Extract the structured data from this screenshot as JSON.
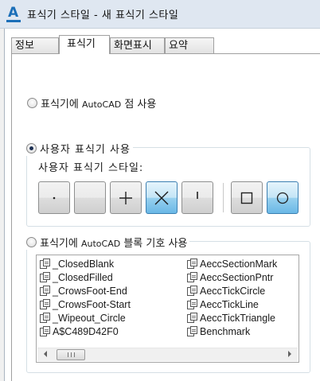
{
  "window": {
    "title": "표식기 스타일 - 새 표식기 스타일"
  },
  "tabs": [
    {
      "label": "정보",
      "active": false
    },
    {
      "label": "표식기",
      "active": true
    },
    {
      "label": "화면표시",
      "active": false
    },
    {
      "label": "요약",
      "active": false
    }
  ],
  "marker_options": {
    "autocad_point": {
      "prefix": "표식기에 ",
      "app": "AutoCAD",
      "suffix": " 점 사용",
      "selected": false
    },
    "custom_marker": {
      "label": "사용자 표식기 사용",
      "selected": true
    },
    "custom_style_label": "사용자 표식기 스타일:",
    "custom_buttons": [
      {
        "name": "dot",
        "selected": false
      },
      {
        "name": "none",
        "selected": false
      },
      {
        "name": "plus",
        "selected": false
      },
      {
        "name": "x",
        "selected": true
      },
      {
        "name": "tick",
        "selected": false
      },
      {
        "name": "square",
        "selected": false
      },
      {
        "name": "circle",
        "selected": true
      }
    ],
    "autocad_block": {
      "prefix": "표식기에 ",
      "app": "AutoCAD",
      "suffix": " 블록 기호 사용",
      "selected": false
    }
  },
  "block_list": {
    "column1": [
      "_ClosedBlank",
      "_ClosedFilled",
      "_CrowsFoot-End",
      "_CrowsFoot-Start",
      "_Wipeout_Circle",
      "A$C489D42F0"
    ],
    "column2": [
      "AeccSectionMark",
      "AeccSectionPntr",
      "AeccTickCircle",
      "AeccTickLine",
      "AeccTickTriangle",
      "Benchmark"
    ]
  },
  "colors": {
    "accent": "#1b6fb8",
    "selected_button": "#98d1ef"
  },
  "icons": [
    "autocad-app-icon",
    "block-icon",
    "scroll-left-arrow-icon",
    "scroll-right-arrow-icon"
  ]
}
